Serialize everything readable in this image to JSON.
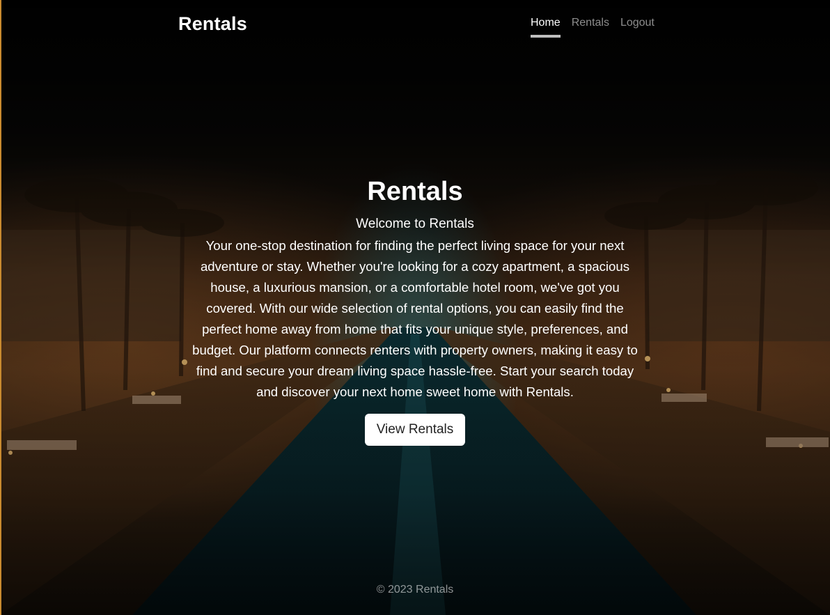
{
  "header": {
    "brand": "Rentals",
    "nav": [
      {
        "label": "Home",
        "active": true
      },
      {
        "label": "Rentals",
        "active": false
      },
      {
        "label": "Logout",
        "active": false
      }
    ]
  },
  "hero": {
    "title": "Rentals",
    "subtitle": "Welcome to Rentals",
    "description": "Your one-stop destination for finding the perfect living space for your next adventure or stay. Whether you're looking for a cozy apartment, a spacious house, a luxurious mansion, or a comfortable hotel room, we've got you covered. With our wide selection of rental options, you can easily find the perfect home away from home that fits your unique style, preferences, and budget. Our platform connects renters with property owners, making it easy to find and secure your dream living space hassle-free. Start your search today and discover your next home sweet home with Rentals.",
    "button_label": "View Rentals"
  },
  "footer": {
    "copyright": "© 2023 Rentals"
  },
  "colors": {
    "accent_edge": "#c98a2f",
    "button_bg": "#ffffff",
    "button_text": "#222222"
  }
}
